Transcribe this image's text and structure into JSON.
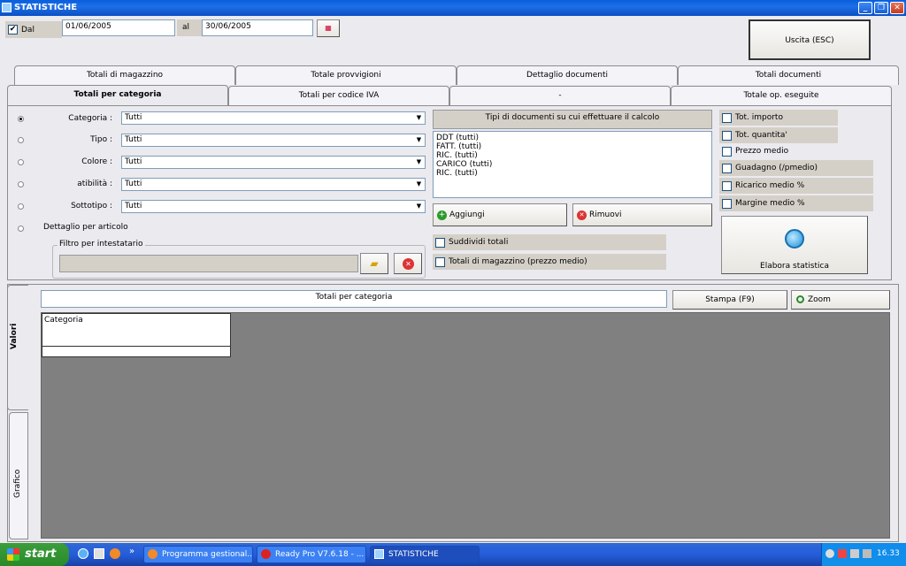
{
  "window": {
    "title": "STATISTICHE"
  },
  "dates": {
    "from_label": "Dal",
    "from_value": "01/06/2005",
    "to_label": "al",
    "to_value": "30/06/2005"
  },
  "exit_label": "Uscita (ESC)",
  "tabs_row1": [
    "Totali di magazzino",
    "Totale provvigioni",
    "Dettaglio documenti",
    "Totali documenti"
  ],
  "tabs_row2": [
    "Totali per categoria",
    "Totali per codice IVA",
    "-",
    "Totale op. eseguite"
  ],
  "filters": [
    {
      "label": "Categoria :",
      "value": "Tutti"
    },
    {
      "label": "Tipo :",
      "value": "Tutti"
    },
    {
      "label": "Colore :",
      "value": "Tutti"
    },
    {
      "label": "atibilità :",
      "value": "Tutti"
    },
    {
      "label": "Sottotipo :",
      "value": "Tutti"
    }
  ],
  "detail_article_label": "Dettaglio per articolo",
  "owner_filter_label": "Filtro per intestatario",
  "doc_types_header": "Tipi di documenti su cui effettuare il calcolo",
  "doc_types": [
    "DDT (tutti)",
    "FATT. (tutti)",
    "RIC. (tutti)",
    "CARICO (tutti)",
    "RIC. (tutti)"
  ],
  "add_label": "Aggiungi",
  "remove_label": "Rimuovi",
  "split_totals_label": "Suddividi totali",
  "stock_totals_label": "Totali di magazzino (prezzo medio)",
  "options": [
    "Tot. importo",
    "Tot. quantita'",
    "Prezzo medio",
    "Guadagno (/pmedio)",
    "Ricarico medio %",
    "Margine medio %"
  ],
  "elaborate_label": "Elabora statistica",
  "result_title": "Totali per categoria",
  "print_label": "Stampa (F9)",
  "zoom_label": "Zoom",
  "vtabs": [
    "Valori",
    "Grafico"
  ],
  "grid_header": "Categoria",
  "taskbar": {
    "start": "start",
    "buttons": [
      "Programma gestional...",
      "Ready Pro V7.6.18 - ...",
      "STATISTICHE"
    ],
    "clock": "16.33"
  },
  "colors": {
    "titlebar": "#0A5FDC",
    "grid_bg": "#808080",
    "taskbar": "#245DDA"
  }
}
